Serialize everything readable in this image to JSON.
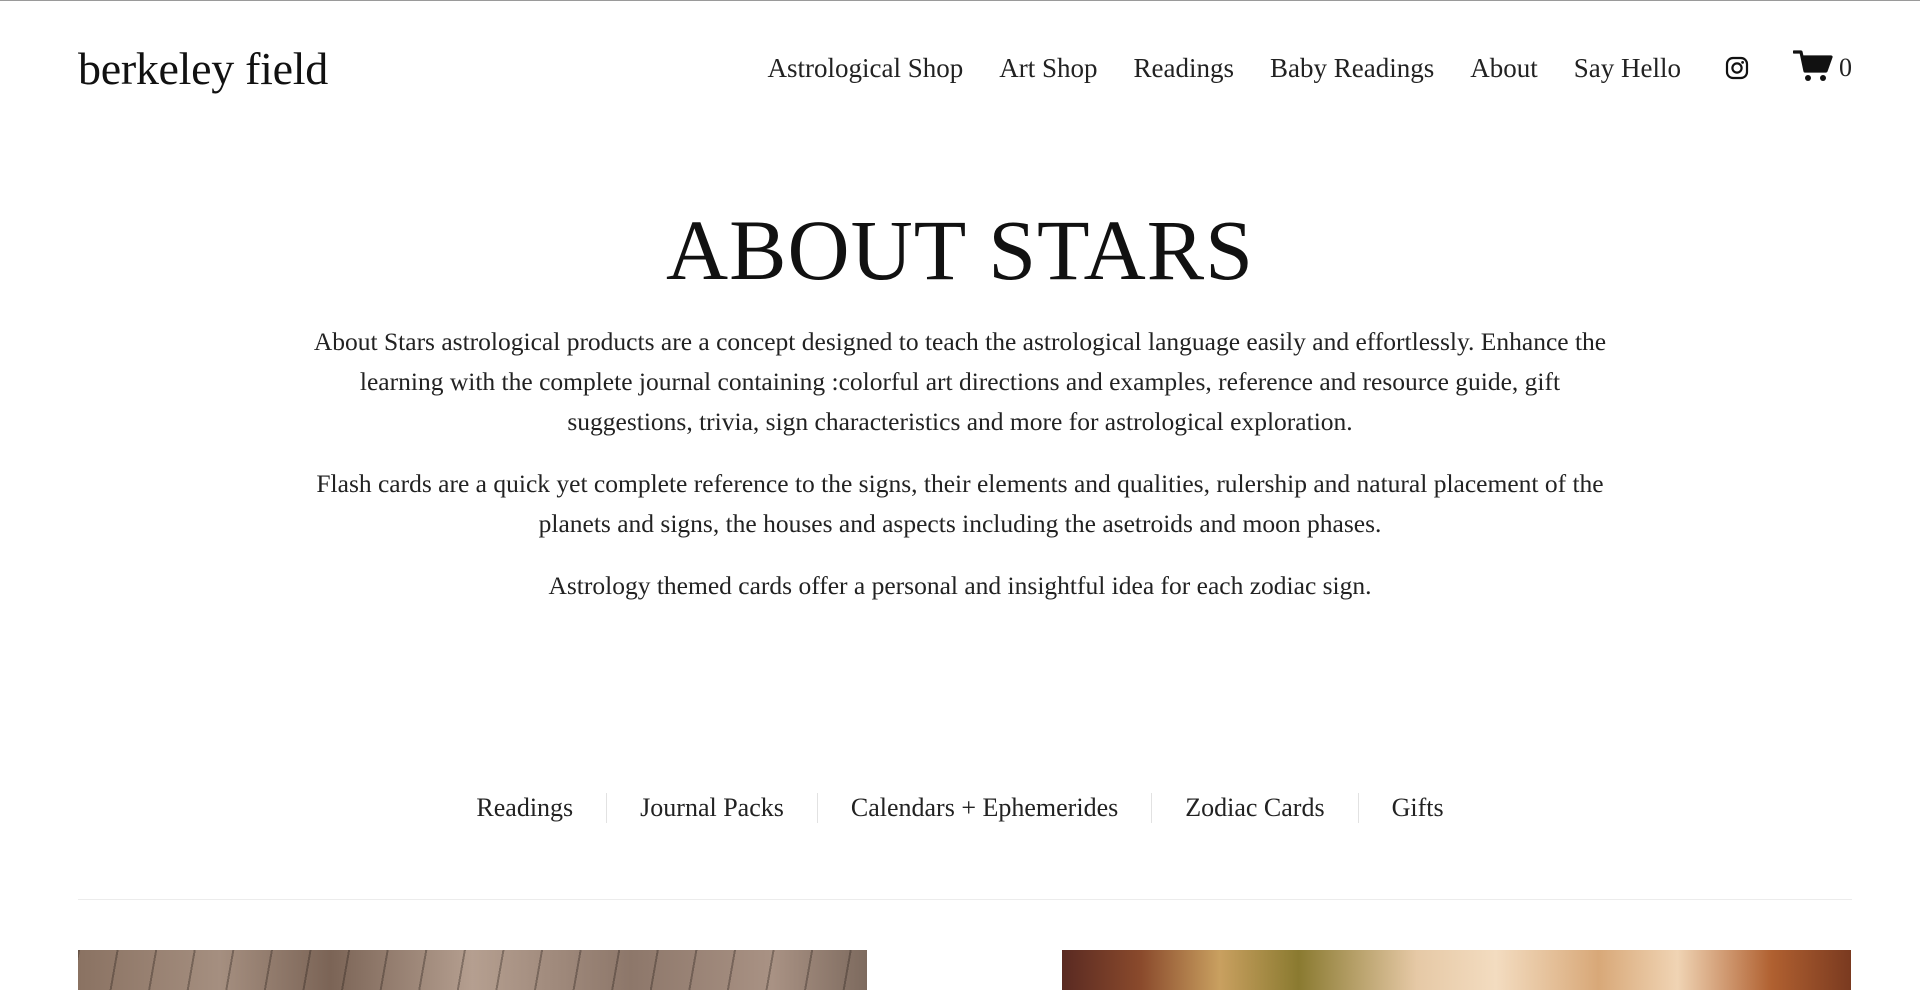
{
  "header": {
    "logo": "berkeley field",
    "nav": [
      "Astrological Shop",
      "Art Shop",
      "Readings",
      "Baby Readings",
      "About",
      "Say Hello"
    ],
    "cart_count": "0"
  },
  "hero": {
    "title": "ABOUT STARS",
    "paragraphs": [
      "About Stars astrological products are a  concept designed to teach the astrological language easily and effortlessly. Enhance the learning with the complete journal containing :colorful art directions and examples, reference and resource guide, gift suggestions, trivia, sign characteristics and more for astrological exploration.",
      "Flash cards are a quick yet complete reference to the signs, their elements and qualities,  rulership and natural placement of the planets and signs, the houses and aspects including the asetroids and moon phases.",
      "Astrology themed cards offer a personal and insightful idea for each zodiac sign."
    ]
  },
  "categories": [
    "Readings",
    "Journal Packs",
    "Calendars + Ephemerides",
    "Zodiac Cards",
    "Gifts"
  ],
  "icons": {
    "social": "instagram-icon",
    "cart": "cart-icon"
  }
}
